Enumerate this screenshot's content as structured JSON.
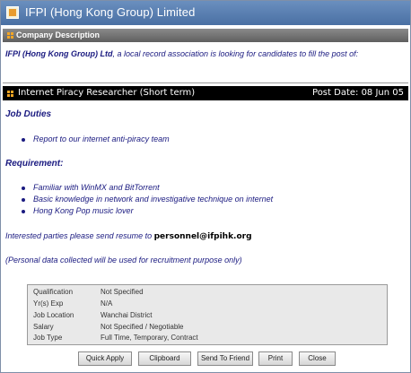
{
  "window": {
    "title": "IFPI (Hong Kong Group) Limited"
  },
  "company_section": {
    "header": "Company Description",
    "intro_name": "IFPI (Hong Kong Group) Ltd",
    "intro_rest": ", a local record association is looking for candidates to fill the post of:"
  },
  "job": {
    "title": "Internet Piracy Researcher (Short term)",
    "post_date": "Post Date: 08 Jun 05",
    "duties_heading": "Job Duties",
    "duties": [
      "Report to our internet anti-piracy team"
    ],
    "requirement_heading": "Requirement:",
    "requirements": [
      "Familiar with WinMX and BitTorrent",
      "Basic knowledge in network and investigative technique on internet",
      "Hong Kong Pop music lover"
    ],
    "apply_text": "Interested parties please send resume to ",
    "apply_email": "personnel@ifpihk.org",
    "privacy_note": "(Personal data collected will be used for recruitment purpose only)"
  },
  "details": [
    {
      "label": "Qualification",
      "value": "Not Specified"
    },
    {
      "label": "Yr(s) Exp",
      "value": "N/A"
    },
    {
      "label": "Job Location",
      "value": "Wanchai District"
    },
    {
      "label": "Salary",
      "value": "Not Specified / Negotiable"
    },
    {
      "label": "Job Type",
      "value": "Full Time, Temporary, Contract"
    }
  ],
  "buttons": {
    "quick_apply": "Quick Apply",
    "clipboard": "Clipboard",
    "send_to_friend": "Send To Friend",
    "print": "Print",
    "close": "Close"
  }
}
